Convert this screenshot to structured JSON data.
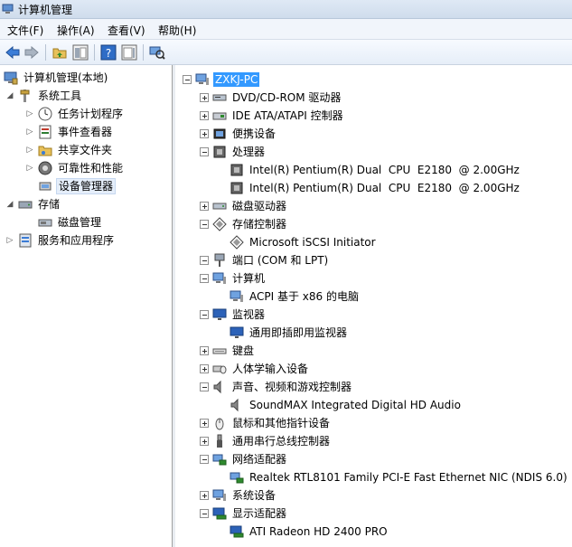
{
  "window": {
    "title": "计算机管理"
  },
  "menu": [
    {
      "label": "文件(F)"
    },
    {
      "label": "操作(A)"
    },
    {
      "label": "查看(V)"
    },
    {
      "label": "帮助(H)"
    }
  ],
  "toolbar": {
    "icons": [
      "back-arrow-icon",
      "forward-arrow-icon",
      "up-folder-icon",
      "show-hide-tree-icon",
      "help-icon",
      "properties-icon",
      "scan-hardware-icon"
    ]
  },
  "left_tree": {
    "root": "计算机管理(本地)",
    "system_tools": "系统工具",
    "task_scheduler": "任务计划程序",
    "event_viewer": "事件查看器",
    "shared_folders": "共享文件夹",
    "reliability": "可靠性和性能",
    "device_manager": "设备管理器",
    "storage": "存储",
    "disk_management": "磁盘管理",
    "services_apps": "服务和应用程序"
  },
  "device_tree": {
    "computer_name": "ZXKJ-PC",
    "dvd": "DVD/CD-ROM 驱动器",
    "ide": "IDE ATA/ATAPI 控制器",
    "portable": "便携设备",
    "processors": "处理器",
    "cpu1": "Intel(R) Pentium(R) Dual  CPU  E2180  @ 2.00GHz",
    "cpu2": "Intel(R) Pentium(R) Dual  CPU  E2180  @ 2.00GHz",
    "disk_drives": "磁盘驱动器",
    "storage_controllers": "存储控制器",
    "iscsi": "Microsoft iSCSI Initiator",
    "ports": "端口 (COM 和 LPT)",
    "computer": "计算机",
    "acpi": "ACPI 基于 x86 的电脑",
    "monitors": "监视器",
    "pnp_monitor": "通用即插即用监视器",
    "keyboards": "键盘",
    "hid": "人体学输入设备",
    "sound": "声音、视频和游戏控制器",
    "soundmax": "SoundMAX Integrated Digital HD Audio",
    "mice": "鼠标和其他指针设备",
    "usb": "通用串行总线控制器",
    "network": "网络适配器",
    "realtek": "Realtek RTL8101 Family PCI-E Fast Ethernet NIC (NDIS 6.0)",
    "system_devices": "系统设备",
    "display": "显示适配器",
    "ati": "ATI Radeon HD 2400 PRO"
  },
  "colors": {
    "selection": "#3399ff",
    "accent_blue": "#1e63c4"
  }
}
